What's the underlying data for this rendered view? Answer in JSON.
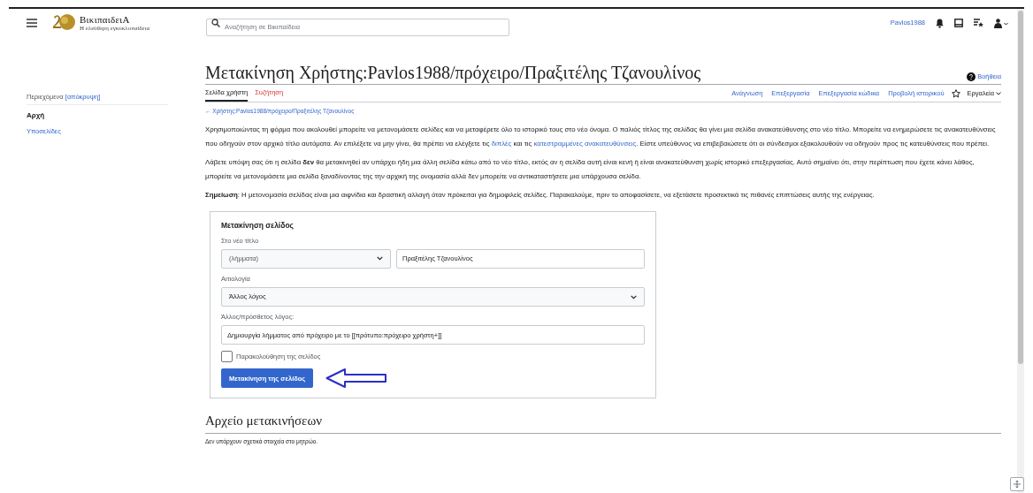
{
  "header": {
    "site_name": "ΒικιπαιδειΑ",
    "tagline": "Η ελεύθερη εγκυκλοπαίδεια",
    "search": {
      "placeholder": "Αναζήτηση σε Βικιπαίδεια"
    },
    "username": "Pavlos1988"
  },
  "sidebar": {
    "title": "Περιεχόμενα",
    "toggle": "[απόκρυψη]",
    "items": [
      {
        "label": "Αρχή",
        "selected": true
      },
      {
        "label": "Υποσελίδες",
        "selected": false
      }
    ]
  },
  "page": {
    "title": "Μετακίνηση Χρήστης:Pavlos1988/πρόχειρο/Πραξιτέλης Τζανουλίνος",
    "help": "Βοήθεια",
    "left_tabs": [
      {
        "label": "Σελίδα χρήστη",
        "selected": true,
        "missing": false
      },
      {
        "label": "Συζήτηση",
        "selected": false,
        "missing": true
      }
    ],
    "right_tabs": [
      {
        "label": "Ανάγνωση"
      },
      {
        "label": "Επεξεργασία"
      },
      {
        "label": "Επεξεργασία κώδικα"
      },
      {
        "label": "Προβολή ιστορικού"
      }
    ],
    "watch_starred": false,
    "tools": "Εργαλεία",
    "breadcrumb": "← Χρήστης:Pavlos1988/πρόχειρο/Πραξιτέλης Τζανουλίνος",
    "paragraphs": [
      [
        {
          "text": "Χρησιμοποιώντας τη φόρμα που ακολουθεί μπορείτε να μετονομάσετε σελίδες και να μεταφέρετε όλο το ιστορικό τους στο νέο όνομα. Ο παλιός τίτλος της σελίδας θα γίνει μια σελίδα ανακατεύθυνσης στο νέο τίτλο. Μπορείτε να ενημερώσετε τις ανακατευθύνσεις που οδηγούν στον αρχικό τίτλο αυτόματα. Αν επιλέξετε να μην γίνει, θα πρέπει να ελέγξετε τις ",
          "link": false
        },
        {
          "text": "διπλές",
          "link": true
        },
        {
          "text": " και τις ",
          "link": false
        },
        {
          "text": "κατεστραμμένες ανακατευθύνσεις",
          "link": true
        },
        {
          "text": ". Είστε υπεύθυνος να επιβεβαιώσετε ότι οι σύνδεσμοι εξακολουθούν να οδηγούν προς τις κατευθύνσεις που πρέπει.",
          "link": false
        }
      ],
      [
        {
          "text": "Λάβετε υπόψη σας ότι η σελίδα **δεν** θα μετακινηθεί αν υπάρχει ήδη μια άλλη σελίδα κάτω από το νέο τίτλο, εκτός αν η σελίδα αυτή είναι κενή ή είναι ανακατεύθυνση χωρίς ιστορικό επεξεργασίας. Αυτό σημαίνει ότι, στην περίπτωση που έχετε κάνει λάθος, μπορείτε να μετονομάσετε μια σελίδα ξαναδίνοντας της την αρχική της ονομασία αλλά δεν μπορείτε να αντικαταστήσετε μια υπάρχουσα σελίδα.",
          "link": false
        }
      ],
      [
        {
          "text": "**Σημείωση**: Η μετονομασία σελίδας είναι μια αιφνίδια και δραστική αλλαγή όταν πρόκειται για δημοφιλείς σελίδες. Παρακαλούμε, πριν το αποφασίσετε, να εξετάσετε προσεκτικά τις πιθανές επιπτώσεις αυτής της ενέργειας.",
          "link": false
        }
      ]
    ],
    "form": {
      "title": "Μετακίνηση σελίδος",
      "new_title_label": "Στο νέο τίτλο",
      "namespace": "(λήμματα)",
      "new_title": "Πραξιτέλης Τζανουλίνος",
      "reason_label": "Αιτιολογία",
      "reason": "Άλλος λόγος",
      "other_reason_label": "Άλλος/πρόσθετος λόγος:",
      "other_reason": "Δημιουργία λήμματος από πρόχειρο με το [[πρότυπο:πρόχειρο χρήστη+]]",
      "watch": {
        "label": "Παρακολούθηση της σελίδος",
        "checked": false
      },
      "submit": "Μετακίνηση της σελίδος"
    },
    "log_title": "Αρχείο μετακινήσεων",
    "log_text": "Δεν υπάρχουν σχετικά στοιχεία στο μητρώο."
  }
}
